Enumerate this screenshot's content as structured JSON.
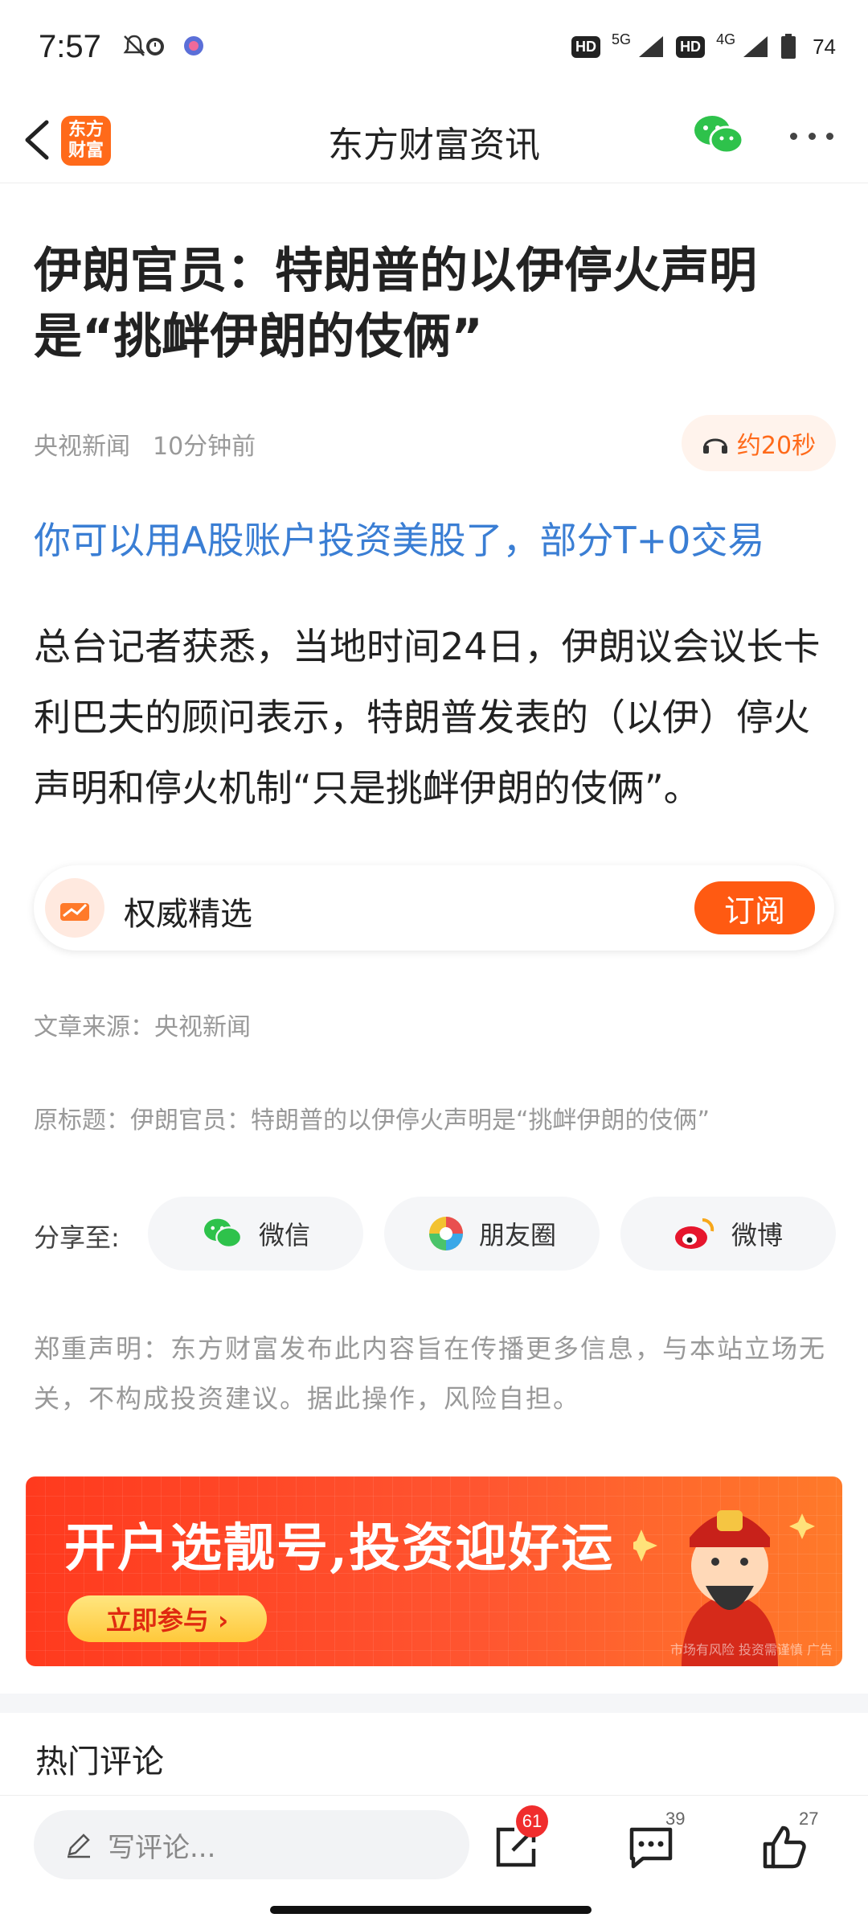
{
  "status_bar": {
    "time": "7:57",
    "hd": "HD",
    "network1": "5G",
    "network2": "4G",
    "battery": "74"
  },
  "nav": {
    "logo_text": "东方\n财富",
    "title": "东方财富资讯"
  },
  "article": {
    "title": "伊朗官员：特朗普的以伊停火声明是“挑衅伊朗的伎俩”",
    "source": "央视新闻",
    "time_ago": "10分钟前",
    "listen_duration": "约20秒",
    "promo_link": "你可以用A股账户投资美股了，部分T+0交易",
    "body": "总台记者获悉，当地时间24日，伊朗议会议长卡利巴夫的顾问表示，特朗普发表的（以伊）停火声明和停火机制“只是挑衅伊朗的伎俩”。",
    "article_source": "文章来源：央视新闻",
    "original_title": "原标题：伊朗官员：特朗普的以伊停火声明是“挑衅伊朗的伎俩”"
  },
  "subscribe": {
    "label": "权威精选",
    "button": "订阅"
  },
  "share": {
    "label": "分享至:",
    "wechat": "微信",
    "moments": "朋友圈",
    "weibo": "微博"
  },
  "disclaimer": "郑重声明：东方财富发布此内容旨在传播更多信息，与本站立场无关，不构成投资建议。据此操作，风险自担。",
  "banner": {
    "headline": "开户选靓号,投资迎好运",
    "cta": "立即参与 ›",
    "fine_print": "市场有风险 投资需谨慎  广告"
  },
  "comments": {
    "heading": "热门评论"
  },
  "bottom_bar": {
    "input_placeholder": "写评论...",
    "share_count": "61",
    "comment_count": "39",
    "like_count": "27"
  },
  "colors": {
    "brand": "#ff6a1a",
    "link": "#3a7ed4",
    "subscribe_button": "#ff5a12",
    "badge": "#f02d2d"
  }
}
